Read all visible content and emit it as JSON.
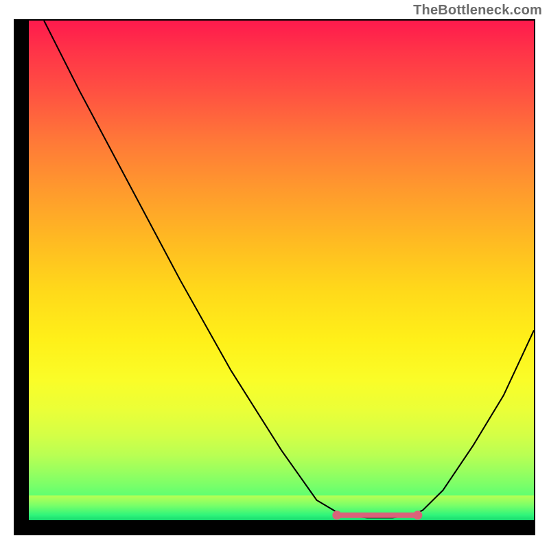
{
  "watermark": "TheBottleneck.com",
  "chart_data": {
    "type": "line",
    "title": "",
    "xlabel": "",
    "ylabel": "",
    "xlim": [
      0,
      100
    ],
    "ylim": [
      0,
      100
    ],
    "grid": false,
    "legend": false,
    "series": [
      {
        "name": "curve",
        "color": "#000000",
        "data_points": [
          {
            "x": 3,
            "y": 100
          },
          {
            "x": 10,
            "y": 86
          },
          {
            "x": 20,
            "y": 67
          },
          {
            "x": 30,
            "y": 48
          },
          {
            "x": 40,
            "y": 30
          },
          {
            "x": 50,
            "y": 14
          },
          {
            "x": 57,
            "y": 4
          },
          {
            "x": 62,
            "y": 1
          },
          {
            "x": 67,
            "y": 0.5
          },
          {
            "x": 72,
            "y": 0.5
          },
          {
            "x": 76,
            "y": 1
          },
          {
            "x": 78,
            "y": 2
          },
          {
            "x": 82,
            "y": 6
          },
          {
            "x": 88,
            "y": 15
          },
          {
            "x": 94,
            "y": 25
          },
          {
            "x": 100,
            "y": 38
          }
        ]
      }
    ],
    "highlight_band": {
      "name": "optimal-range",
      "color": "#d9637a",
      "x_start": 61,
      "x_end": 77,
      "y": 1
    },
    "gradient_background": {
      "top": "#ff1a4d",
      "middle": "#ffe728",
      "bottom": "#18d96f"
    }
  }
}
